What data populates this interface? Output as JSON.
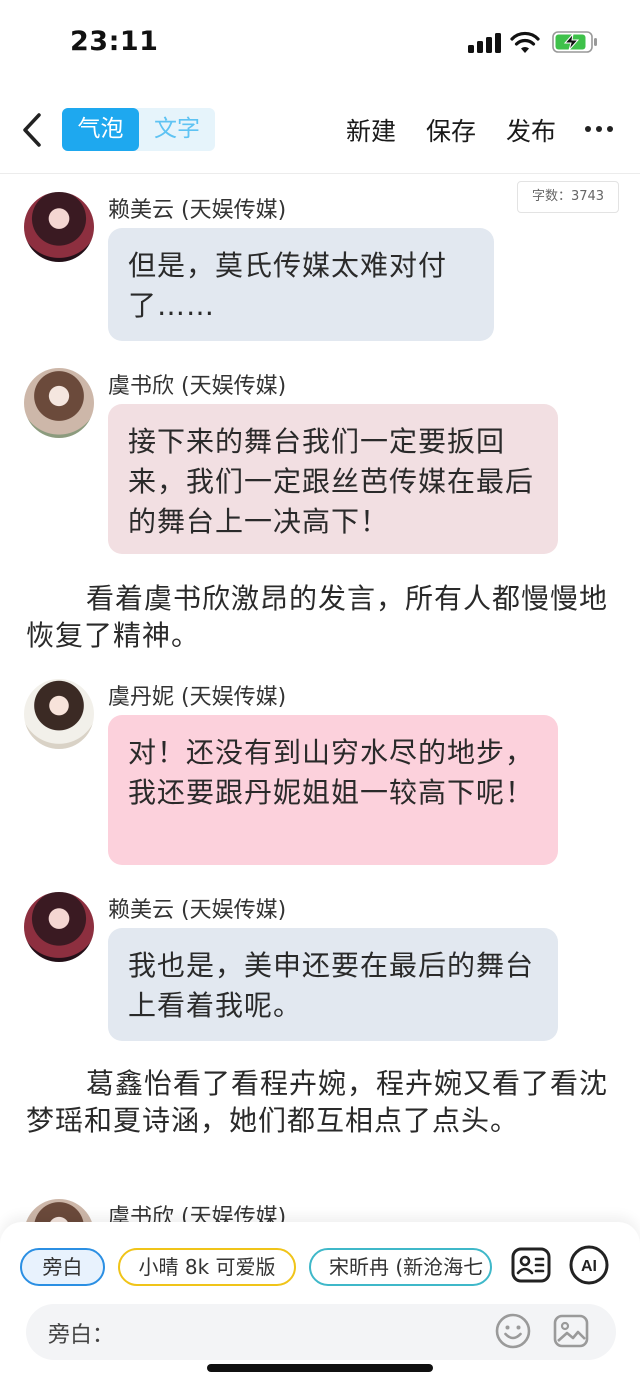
{
  "status": {
    "time": "23:11"
  },
  "nav": {
    "seg_bubble": "气泡",
    "seg_text": "文字",
    "new": "新建",
    "save": "保存",
    "publish": "发布"
  },
  "word_count": "字数：3743",
  "messages": [
    {
      "speaker": "赖美云 (天娱传媒)",
      "text": "但是，莫氏传媒太难对付了……"
    },
    {
      "speaker": "虞书欣 (天娱传媒)",
      "text": "接下来的舞台我们一定要扳回来，我们一定跟丝芭传媒在最后的舞台上一决高下！"
    },
    {
      "speaker": "虞丹妮 (天娱传媒)",
      "text": "对！还没有到山穷水尽的地步，我还要跟丹妮姐姐一较高下呢！"
    },
    {
      "speaker": "赖美云 (天娱传媒)",
      "text": "我也是，美申还要在最后的舞台上看着我呢。"
    },
    {
      "speaker": "虞书欣 (天娱传媒)"
    }
  ],
  "narrations": [
    "看着虞书欣激昂的发言，所有人都慢慢地恢复了精神。",
    "葛鑫怡看了看程卉婉，程卉婉又看了看沈梦瑶和夏诗涵，她们都互相点了点头。"
  ],
  "bottom": {
    "chips": [
      {
        "label": "旁白",
        "color": "#2b8fe3",
        "bg": "#e8f2fd"
      },
      {
        "label": "小晴 8k 可爱版",
        "color": "#f0c419",
        "bg": "#ffffff"
      },
      {
        "label": "宋昕冉 (新沧海七",
        "color": "#3fb8c9",
        "bg": "#ffffff"
      }
    ],
    "ai_label": "AI",
    "input_label": "旁白："
  }
}
